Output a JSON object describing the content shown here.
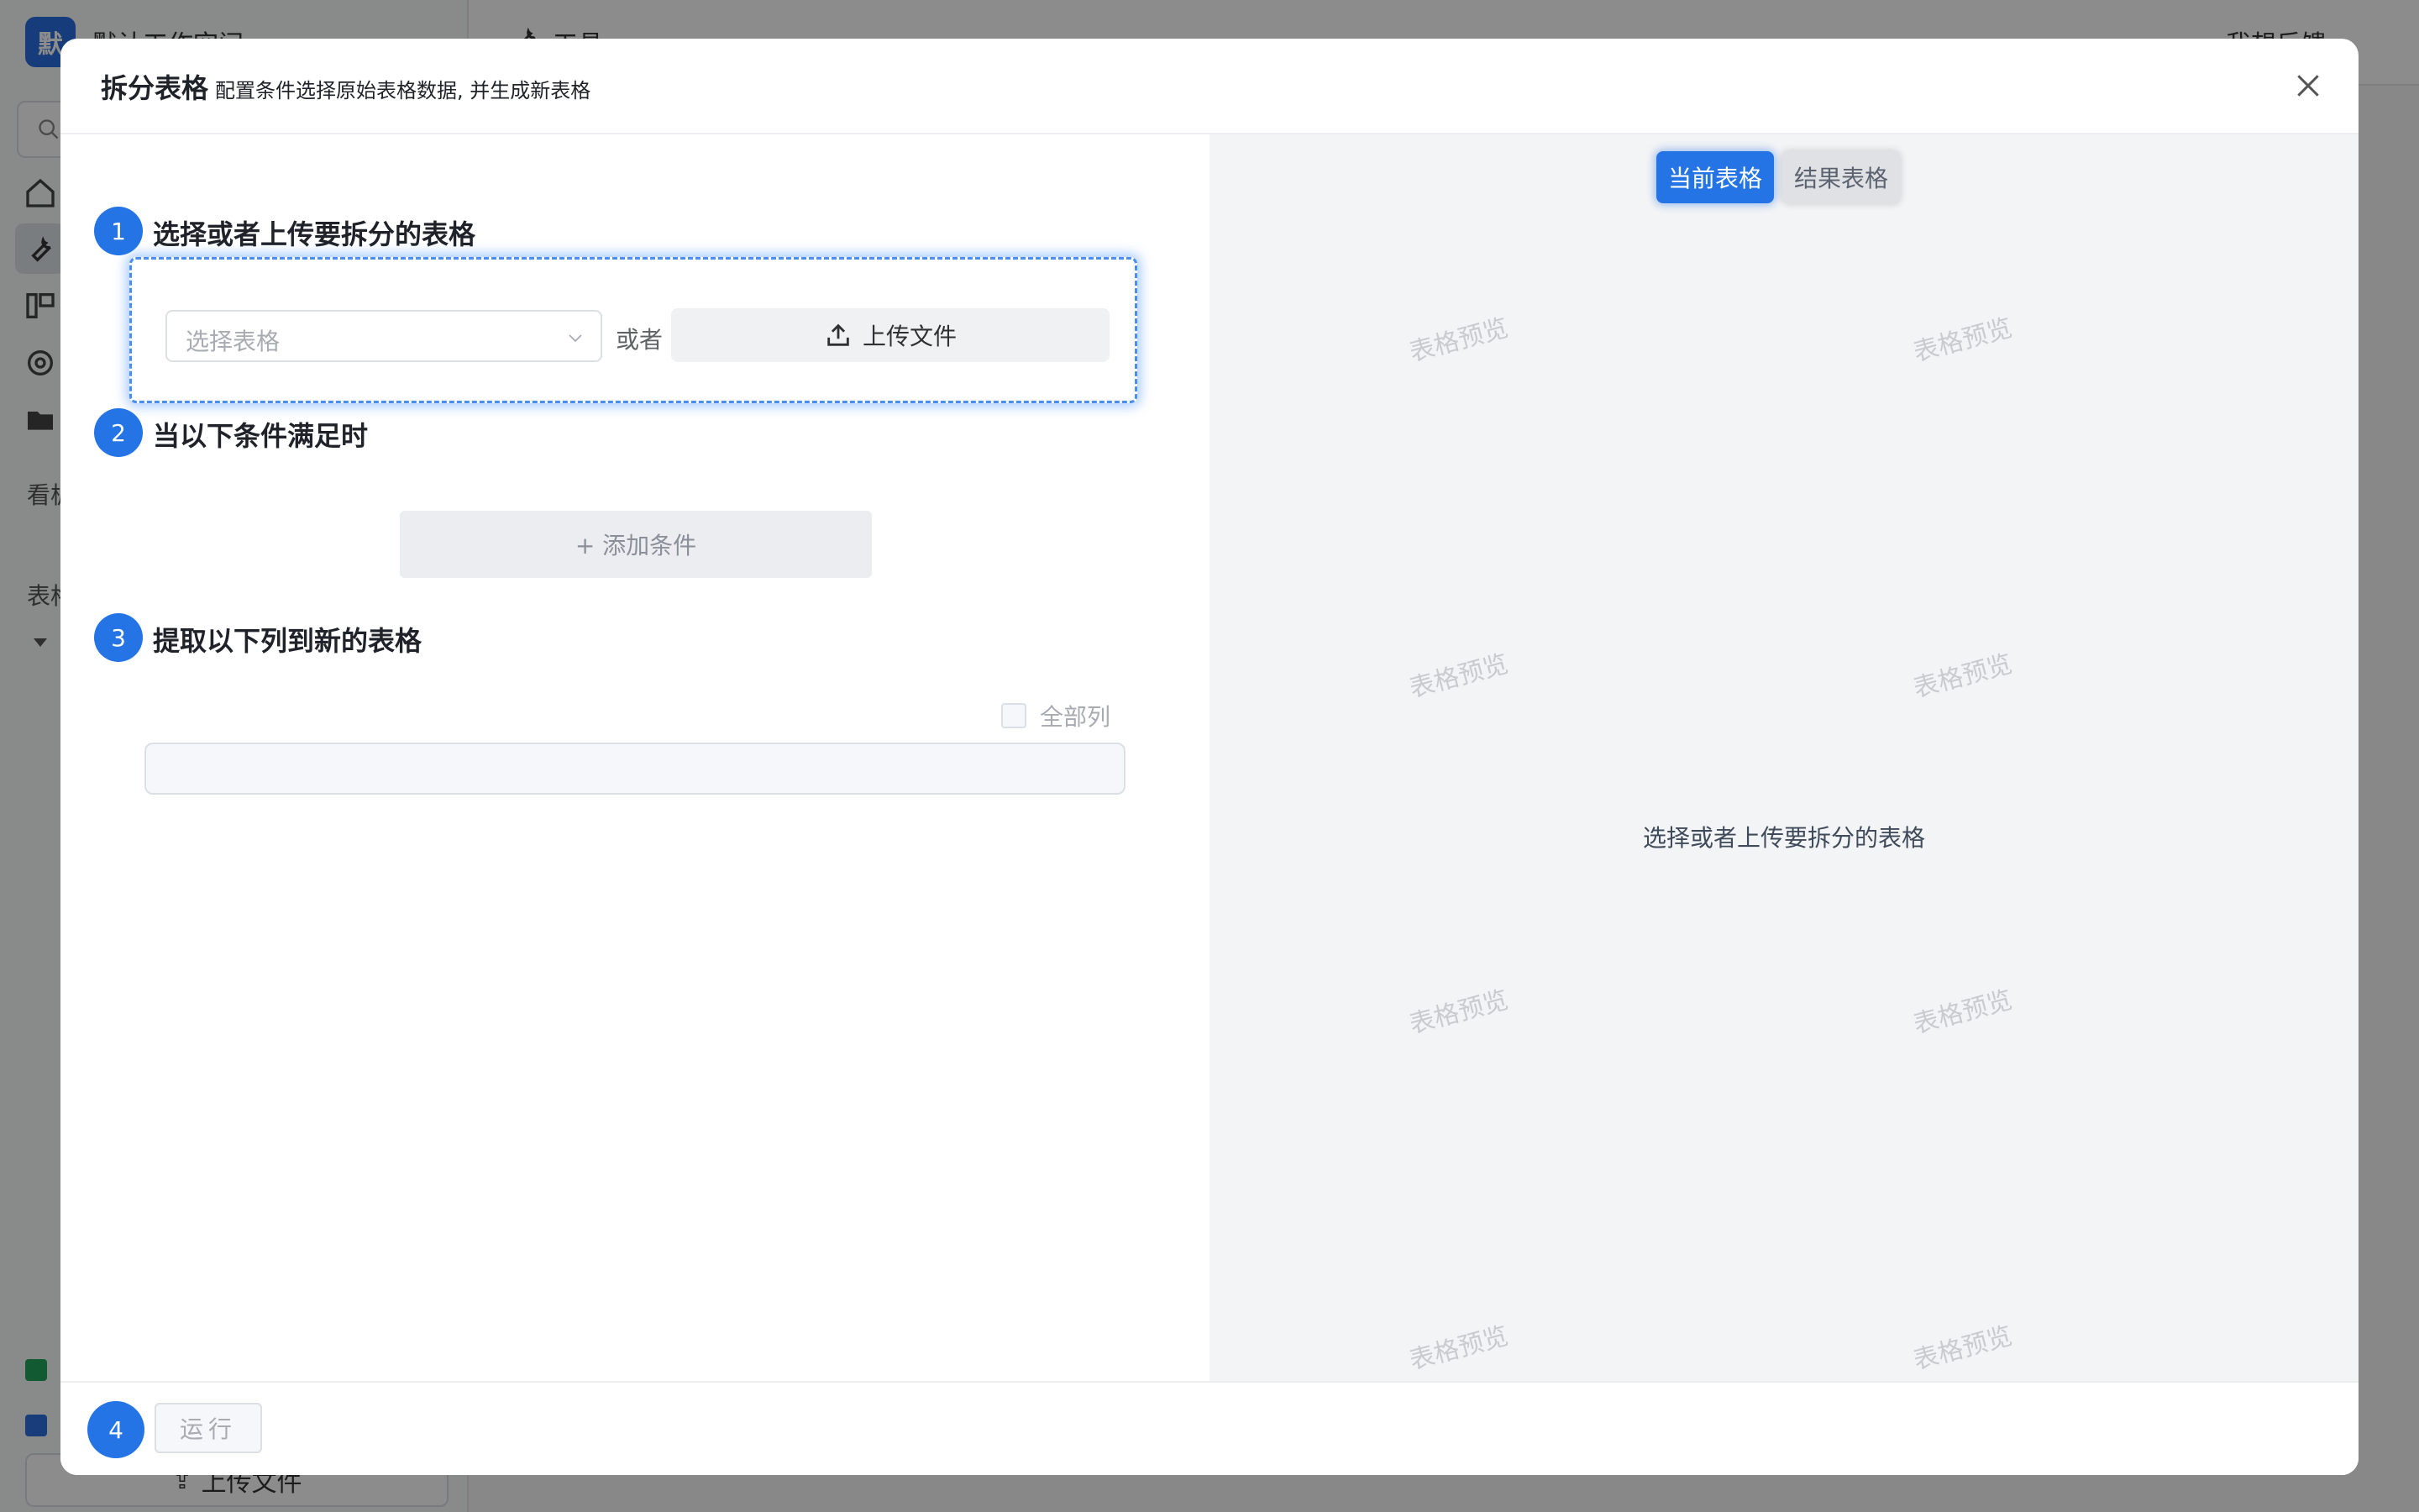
{
  "background": {
    "workspace_logo": "默",
    "workspace_name": "默认工作空间",
    "topbar_title": "工具",
    "topbar_feedback": "我想反馈",
    "sidebar_section_1": "看板",
    "sidebar_section_2": "表格",
    "sidebar_upload_label": "上传文件"
  },
  "modal": {
    "title": "拆分表格",
    "subtitle": "配置条件选择原始表格数据, 并生成新表格",
    "steps": [
      {
        "number": "1",
        "title": "选择或者上传要拆分的表格"
      },
      {
        "number": "2",
        "title": "当以下条件满足时"
      },
      {
        "number": "3",
        "title": "提取以下列到新的表格"
      },
      {
        "number": "4"
      }
    ],
    "select_table_placeholder": "选择表格",
    "or_text": "或者",
    "upload_label": "上传文件",
    "add_condition_label": "+ 添加条件",
    "all_columns_label": "全部列",
    "run_label": "运行"
  },
  "preview": {
    "tabs": [
      {
        "label": "当前表格",
        "active": true
      },
      {
        "label": "结果表格",
        "active": false
      }
    ],
    "watermark": "表格预览",
    "empty_message": "选择或者上传要拆分的表格"
  },
  "colors": {
    "accent": "#2474e6",
    "drop_zone_border": "#4a8ef0",
    "preview_bg": "#f3f4f5"
  }
}
